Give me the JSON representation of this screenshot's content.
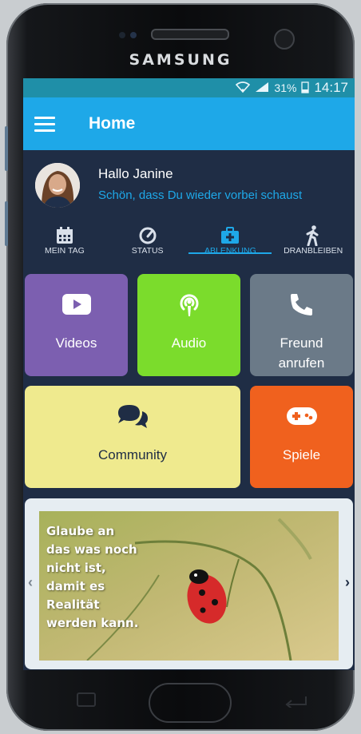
{
  "device": {
    "brand": "SAMSUNG"
  },
  "statusbar": {
    "battery": "31%",
    "time": "14:17"
  },
  "appbar": {
    "title": "Home"
  },
  "greeting": {
    "hello": "Hallo Janine",
    "subtitle": "Schön, dass Du wieder vorbei schaust"
  },
  "tabs": [
    {
      "label": "MEIN TAG",
      "icon": "calendar-icon"
    },
    {
      "label": "STATUS",
      "icon": "gauge-icon"
    },
    {
      "label": "ABLENKUNG",
      "icon": "medkit-icon",
      "active": true
    },
    {
      "label": "DRANBLEIBEN",
      "icon": "walking-icon"
    }
  ],
  "tiles": [
    {
      "label": "Videos",
      "icon": "youtube-icon",
      "color": "#7c5fb0"
    },
    {
      "label": "Audio",
      "icon": "podcast-icon",
      "color": "#7bdc2c"
    },
    {
      "label": "Freund\nanrufen",
      "icon": "phone-icon",
      "color": "#6b7a88"
    },
    {
      "label": "Community",
      "icon": "chat-icon",
      "color": "#efea8e"
    },
    {
      "label": "Spiele",
      "icon": "gamepad-icon",
      "color": "#f0611e"
    }
  ],
  "quote": {
    "text": "Glaube an\ndas was noch\nnicht ist,\ndamit es\nRealität\nwerden kann."
  },
  "colors": {
    "accent": "#1ea8e8",
    "appbar": "#1ea8e8",
    "statusbar": "#1f8fa8",
    "background": "#1f2d45"
  }
}
